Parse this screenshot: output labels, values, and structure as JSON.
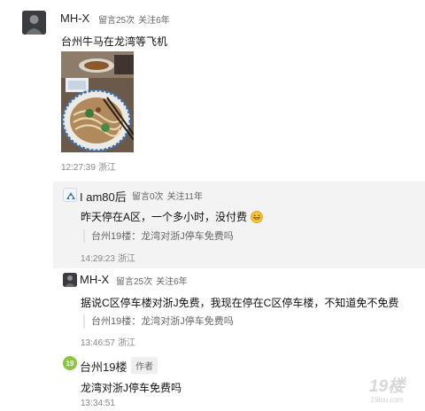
{
  "posts": [
    {
      "username": "MH-X",
      "replies": "留言25次",
      "follow": "关注6年",
      "content": "台州牛马在龙湾等飞机",
      "time": "12:27:39",
      "location": "浙江"
    },
    {
      "username": "I am80后",
      "replies": "留言0次",
      "follow": "关注11年",
      "content": "昨天停在A区，一个多小时，没付费",
      "emoji": "grinning-emoji",
      "quote": "台州19楼：龙湾对浙J停车免费吗",
      "time": "14:29:23",
      "location": "浙江"
    },
    {
      "username": "MH-X",
      "replies": "留言25次",
      "follow": "关注6年",
      "content": "据说C区停车楼对浙J免费，我现在停在C区停车楼，不知道免不免费",
      "quote": "台州19楼：龙湾对浙J停车免费吗",
      "time": "13:46:57",
      "location": "浙江"
    },
    {
      "username": "台州19楼",
      "author_tag": "作者",
      "content": "龙湾对浙J停车免费吗",
      "time": "13:34:51"
    }
  ],
  "watermark": {
    "logo_text": "19楼",
    "url": "19lou.com"
  },
  "colors": {
    "sub_panel": "#f3f3f3",
    "brand_green": "#8cc63f",
    "watermark": "#d8d8d8"
  }
}
